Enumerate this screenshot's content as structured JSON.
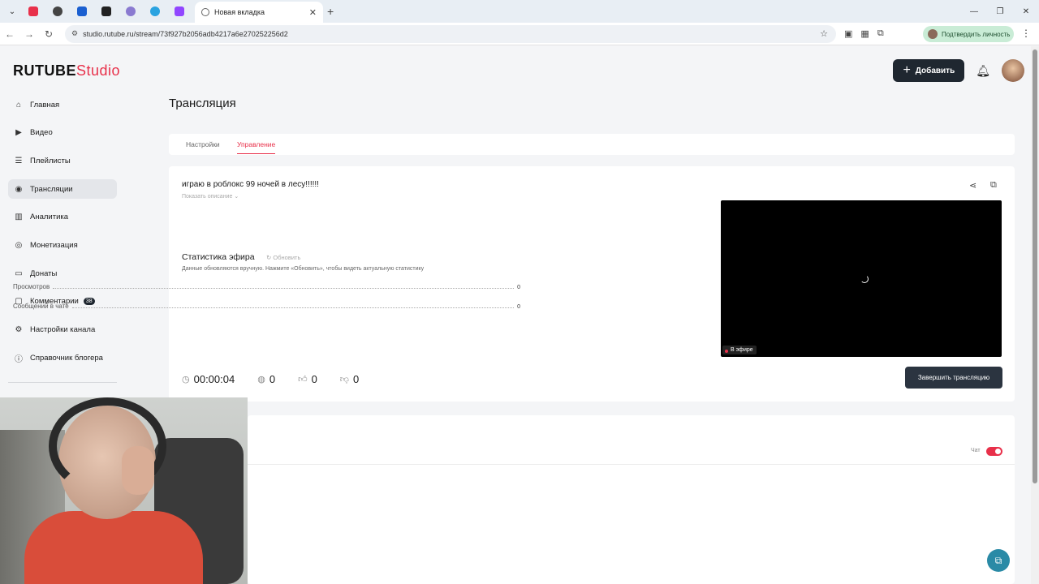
{
  "browser": {
    "tab_title": "Новая вкладка",
    "url": "studio.rutube.ru/stream/73f927b2056adb4217a6e270252256d2",
    "verify_label": "Подтвердить личность"
  },
  "header": {
    "logo_main": "RUTUBE",
    "logo_studio": "Studio",
    "add_label": "Добавить"
  },
  "sidebar": {
    "items": [
      {
        "label": "Главная"
      },
      {
        "label": "Видео"
      },
      {
        "label": "Плейлисты"
      },
      {
        "label": "Трансляции"
      },
      {
        "label": "Аналитика"
      },
      {
        "label": "Монетизация"
      },
      {
        "label": "Донаты"
      },
      {
        "label": "Комментарии",
        "badge": "38"
      },
      {
        "label": "Настройки канала"
      },
      {
        "label": "Справочник блогера"
      }
    ]
  },
  "main": {
    "page_title": "Трансляция",
    "tabs": [
      {
        "label": "Настройки"
      },
      {
        "label": "Управление"
      }
    ],
    "stream_title": "играю в роблокс 99 ночей в лесу!!!!!!",
    "show_description": "Показать описание",
    "stats_title": "Статистика эфира",
    "refresh_label": "Обновить",
    "stats_note": "Данные обновляются вручную. Нажмите «Обновить», чтобы видеть актуальную статистику",
    "stats": [
      {
        "label": "Просмотров",
        "value": "0"
      },
      {
        "label": "Сообщений в чате",
        "value": "0"
      }
    ],
    "live_badge": "В эфире",
    "metrics": {
      "duration": "00:00:04",
      "viewers": "0",
      "likes": "0",
      "dislikes": "0"
    },
    "end_stream_label": "Завершить трансляцию",
    "chat_label": "Чат"
  },
  "colors": {
    "accent": "#e8304a",
    "dark_button": "#1f2730",
    "help_button": "#2a8aa6"
  }
}
